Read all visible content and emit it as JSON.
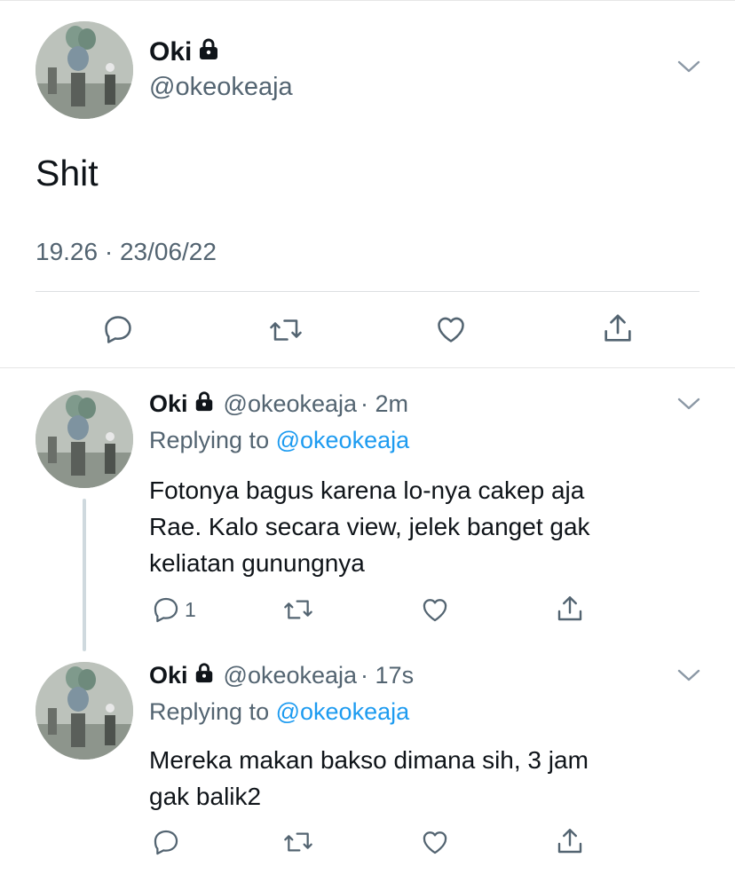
{
  "main_tweet": {
    "name": "Oki",
    "handle": "@okeokeaja",
    "text": "Shit",
    "timestamp": "19.26 · 23/06/22"
  },
  "replies": [
    {
      "name": "Oki",
      "handle": "@okeokeaja",
      "time": "· 2m",
      "replying_prefix": "Replying to",
      "replying_to": "@okeokeaja",
      "lines": [
        "Fotonya bagus karena lo-nya cakep aja",
        "Rae. Kalo secara view, jelek banget gak",
        "keliatan gunungnya"
      ],
      "reply_count": "1"
    },
    {
      "name": "Oki",
      "handle": "@okeokeaja",
      "time": "· 17s",
      "replying_prefix": "Replying to",
      "replying_to": "@okeokeaja",
      "lines": [
        "Mereka makan bakso dimana sih, 3 jam",
        "gak balik2"
      ],
      "reply_count": ""
    }
  ],
  "colors": {
    "text": "#0f1419",
    "secondary": "#536471",
    "link": "#1d9bf0",
    "thread_line": "#cfd9de"
  },
  "icons": [
    "lock-icon",
    "chevron-down-icon",
    "reply-icon",
    "retweet-icon",
    "like-icon",
    "share-icon"
  ]
}
